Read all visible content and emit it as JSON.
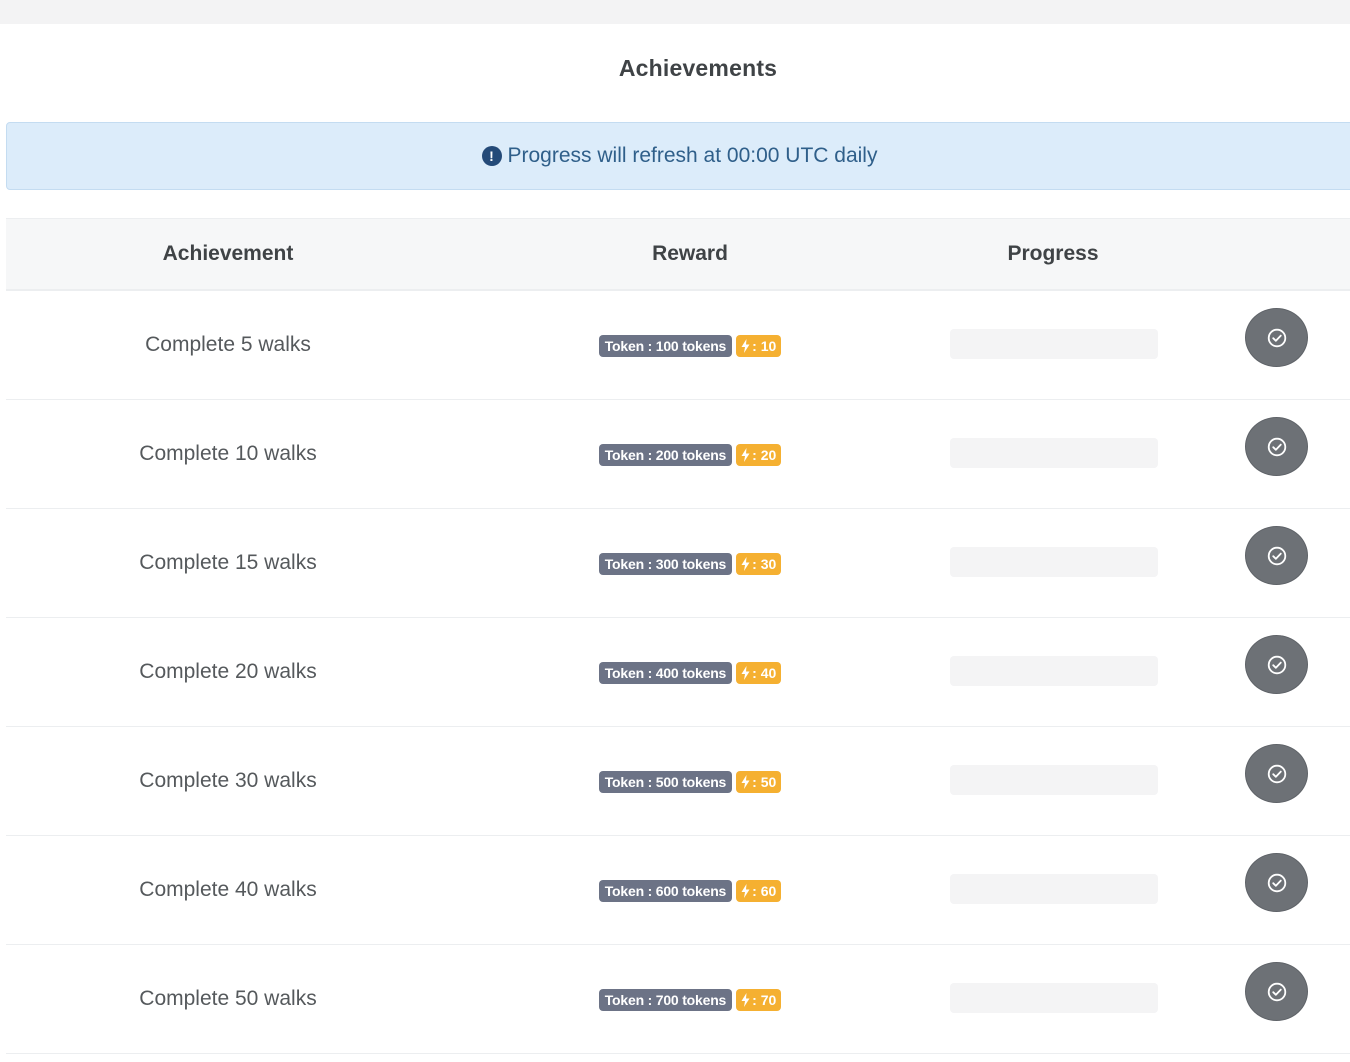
{
  "page": {
    "title": "Achievements",
    "notice": "Progress will refresh at 00:00 UTC daily"
  },
  "table": {
    "headers": [
      "Achievement",
      "Reward",
      "Progress"
    ],
    "rows": [
      {
        "achievement": "Complete 5 walks",
        "token": "Token : 100 tokens",
        "energy": ": 10",
        "progress": 0
      },
      {
        "achievement": "Complete 10 walks",
        "token": "Token : 200 tokens",
        "energy": ": 20",
        "progress": 0
      },
      {
        "achievement": "Complete 15 walks",
        "token": "Token : 300 tokens",
        "energy": ": 30",
        "progress": 0
      },
      {
        "achievement": "Complete 20 walks",
        "token": "Token : 400 tokens",
        "energy": ": 40",
        "progress": 0
      },
      {
        "achievement": "Complete 30 walks",
        "token": "Token : 500 tokens",
        "energy": ": 50",
        "progress": 0
      },
      {
        "achievement": "Complete 40 walks",
        "token": "Token : 600 tokens",
        "energy": ": 60",
        "progress": 0
      },
      {
        "achievement": "Complete 50 walks",
        "token": "Token : 700 tokens",
        "energy": ": 70",
        "progress": 0
      }
    ]
  },
  "icons": {
    "notice": "info-circle-icon",
    "energy": "bolt-icon",
    "claim": "check-circle-icon"
  },
  "colors": {
    "alert_bg": "#dcecfa",
    "token_badge": "#6c7386",
    "energy_badge": "#f5b031",
    "claim_button": "#6d7176"
  }
}
